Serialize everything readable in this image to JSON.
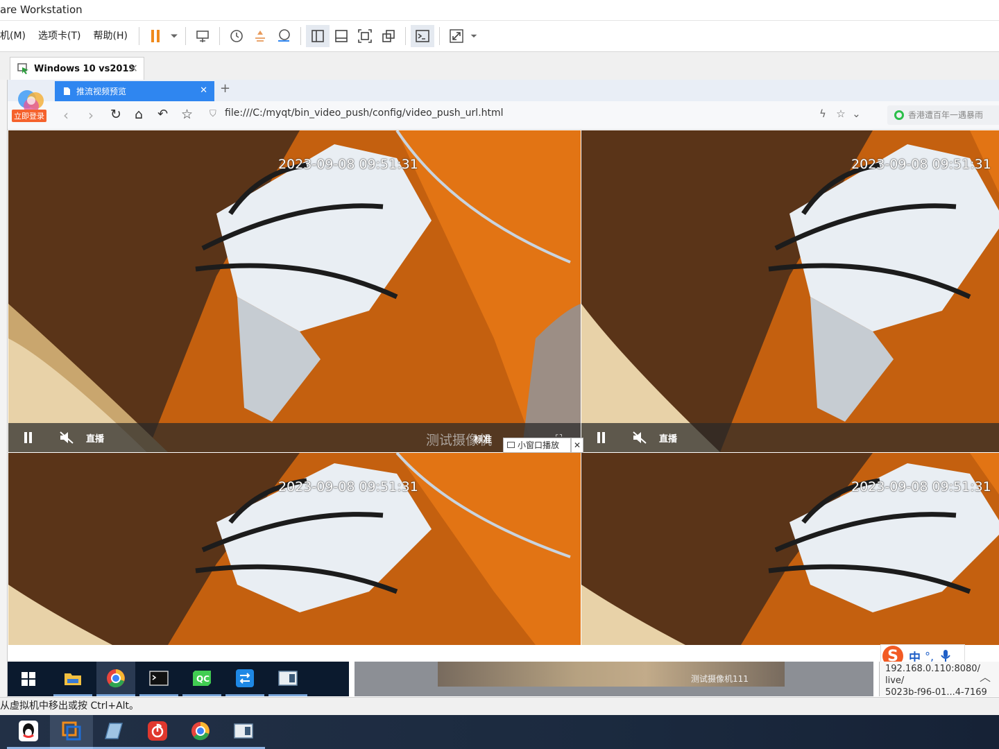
{
  "vmware": {
    "title": "are Workstation",
    "menus": [
      "机(M)",
      "选项卡(T)",
      "帮助(H)"
    ],
    "tab_label": "Windows 10 vs2019",
    "status_text": "从虚拟机中移出或按 Ctrl+Alt。"
  },
  "browser": {
    "login_badge": "立即登录",
    "tab_title": "推流视频预览",
    "url": "file:///C:/myqt/bin_video_push/config/video_push_url.html",
    "search_placeholder": "香港遭百年一遇暴雨"
  },
  "videos": [
    {
      "timestamp": "2023-09-08 09:51:31",
      "live_label": "直播"
    },
    {
      "timestamp": "2023-09-08 09:51:31",
      "live_label": "直播"
    },
    {
      "timestamp": "2023-09-08 09:51:31"
    },
    {
      "timestamp": "2023-09-08 09:51:31"
    }
  ],
  "overlays": {
    "camera_name": "测试摄像机",
    "quality_label": "标准",
    "mini_window_button": "小窗口播放",
    "mini_close": "✕",
    "blurred_camera_name": "测试摄像机111"
  },
  "guest_panel_lines": [
    "192.168.0.110:8080/",
    "live/",
    "5023b-f96-01...4-7169"
  ],
  "ime": {
    "logo": "S",
    "lang": "中"
  }
}
